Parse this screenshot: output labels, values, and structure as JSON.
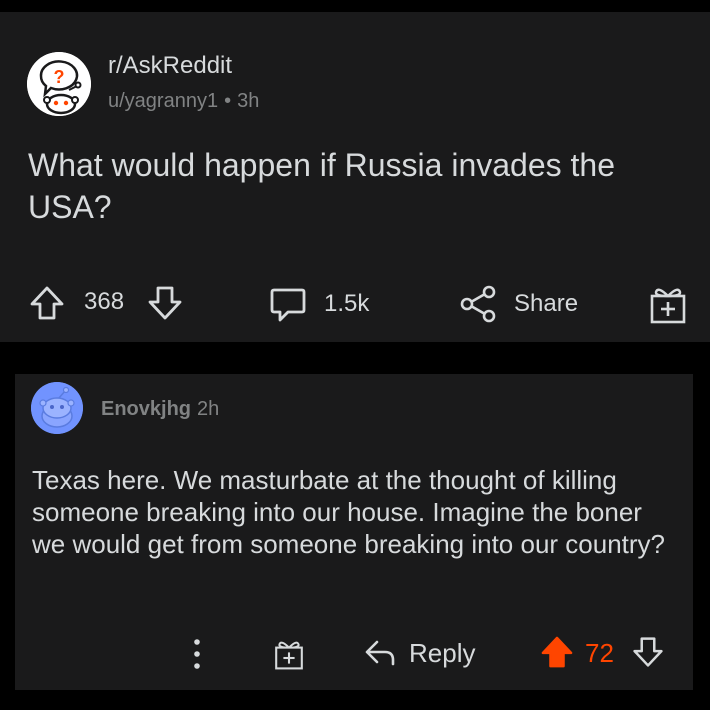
{
  "post": {
    "subreddit": "r/AskReddit",
    "author": "u/yagranny1",
    "separator": "•",
    "age": "3h",
    "title": "What would happen if Russia invades the USA?",
    "score": "368",
    "comments": "1.5k",
    "share_label": "Share"
  },
  "comment": {
    "username": "Enovkjhg",
    "age": "2h",
    "body": "Texas here. We masturbate at the thought of killing someone breaking into our house. Imagine the boner we would get from someone breaking into our country?",
    "reply_label": "Reply",
    "score": "72"
  },
  "colors": {
    "background": "#000000",
    "card": "#1a1a1b",
    "text": "#d7dadc",
    "muted": "#818384",
    "upvote_active": "#ff4500",
    "comment_avatar": "#7193ff"
  },
  "icons": {
    "subreddit_avatar": "askreddit-snoo-icon",
    "upvote": "arrow-up-icon",
    "downvote": "arrow-down-icon",
    "comments": "chat-bubble-icon",
    "share": "share-icon",
    "award": "gift-icon",
    "more": "more-vertical-icon",
    "reply": "reply-arrow-icon"
  }
}
